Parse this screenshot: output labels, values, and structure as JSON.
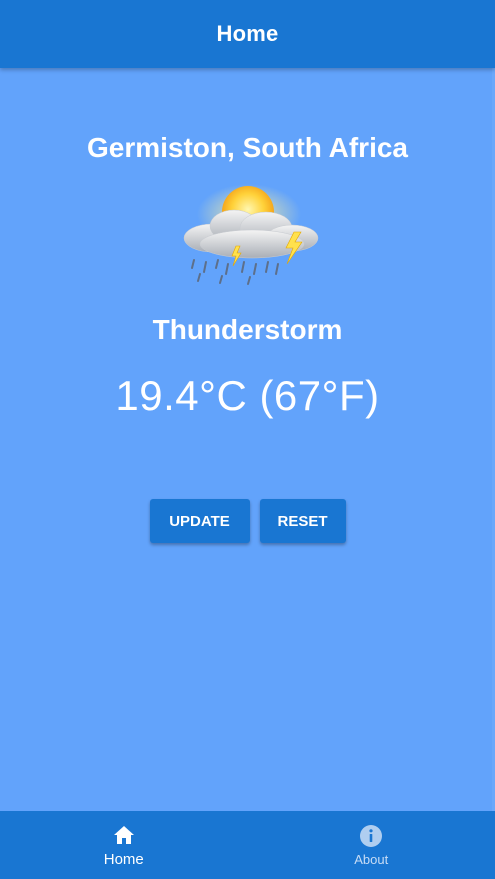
{
  "app_bar": {
    "title": "Home"
  },
  "weather": {
    "location": "Germiston, South Africa",
    "condition": "Thunderstorm",
    "temperature": "19.4°C (67°F)",
    "icon": "thunderstorm-sun-icon"
  },
  "actions": {
    "update_label": "UPDATE",
    "reset_label": "RESET"
  },
  "bottom_nav": {
    "items": [
      {
        "label": "Home",
        "icon": "home-icon",
        "active": true
      },
      {
        "label": "About",
        "icon": "info-icon",
        "active": false
      }
    ]
  },
  "colors": {
    "primary": "#1976d2",
    "background": "#62a3fb",
    "text": "#ffffff"
  }
}
